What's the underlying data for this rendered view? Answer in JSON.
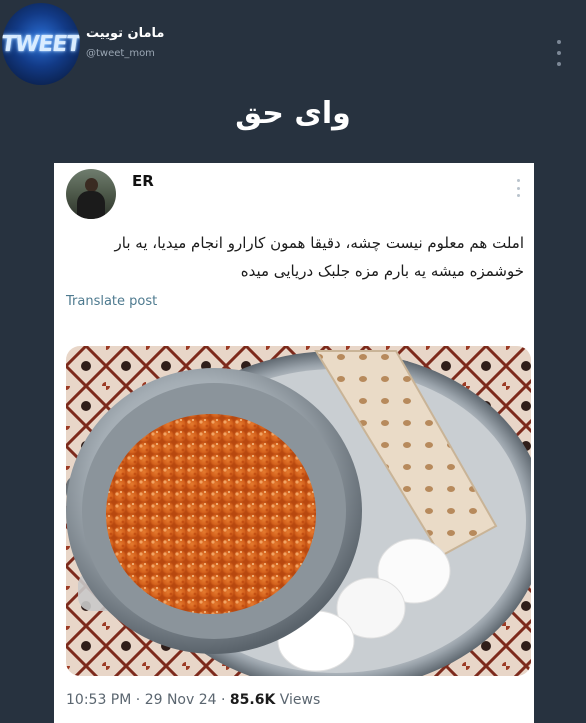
{
  "channel": {
    "name": "مامان توییت",
    "handle": "@tweet_mom",
    "avatar_text": "TWEET",
    "avatar_icon": "tweet-channel-logo"
  },
  "caption": "وای حق",
  "tweet": {
    "author": "ER",
    "text": "املت هم معلوم نیست چشه، دقیقا همون کارارو انجام میدیا، یه بار خوشمزه میشه یه بارم مزه جلبک دریایی میده",
    "translate_label": "Translate post",
    "photo_icon": "omelette-photo",
    "time": "10:53 PM",
    "date": "29 Nov 24",
    "separator": "·",
    "views_count": "85.6K",
    "views_label": "Views"
  },
  "colors": {
    "background": "#27323f",
    "card": "#ffffff",
    "link": "#4e7a8f",
    "muted": "#5b6670"
  }
}
